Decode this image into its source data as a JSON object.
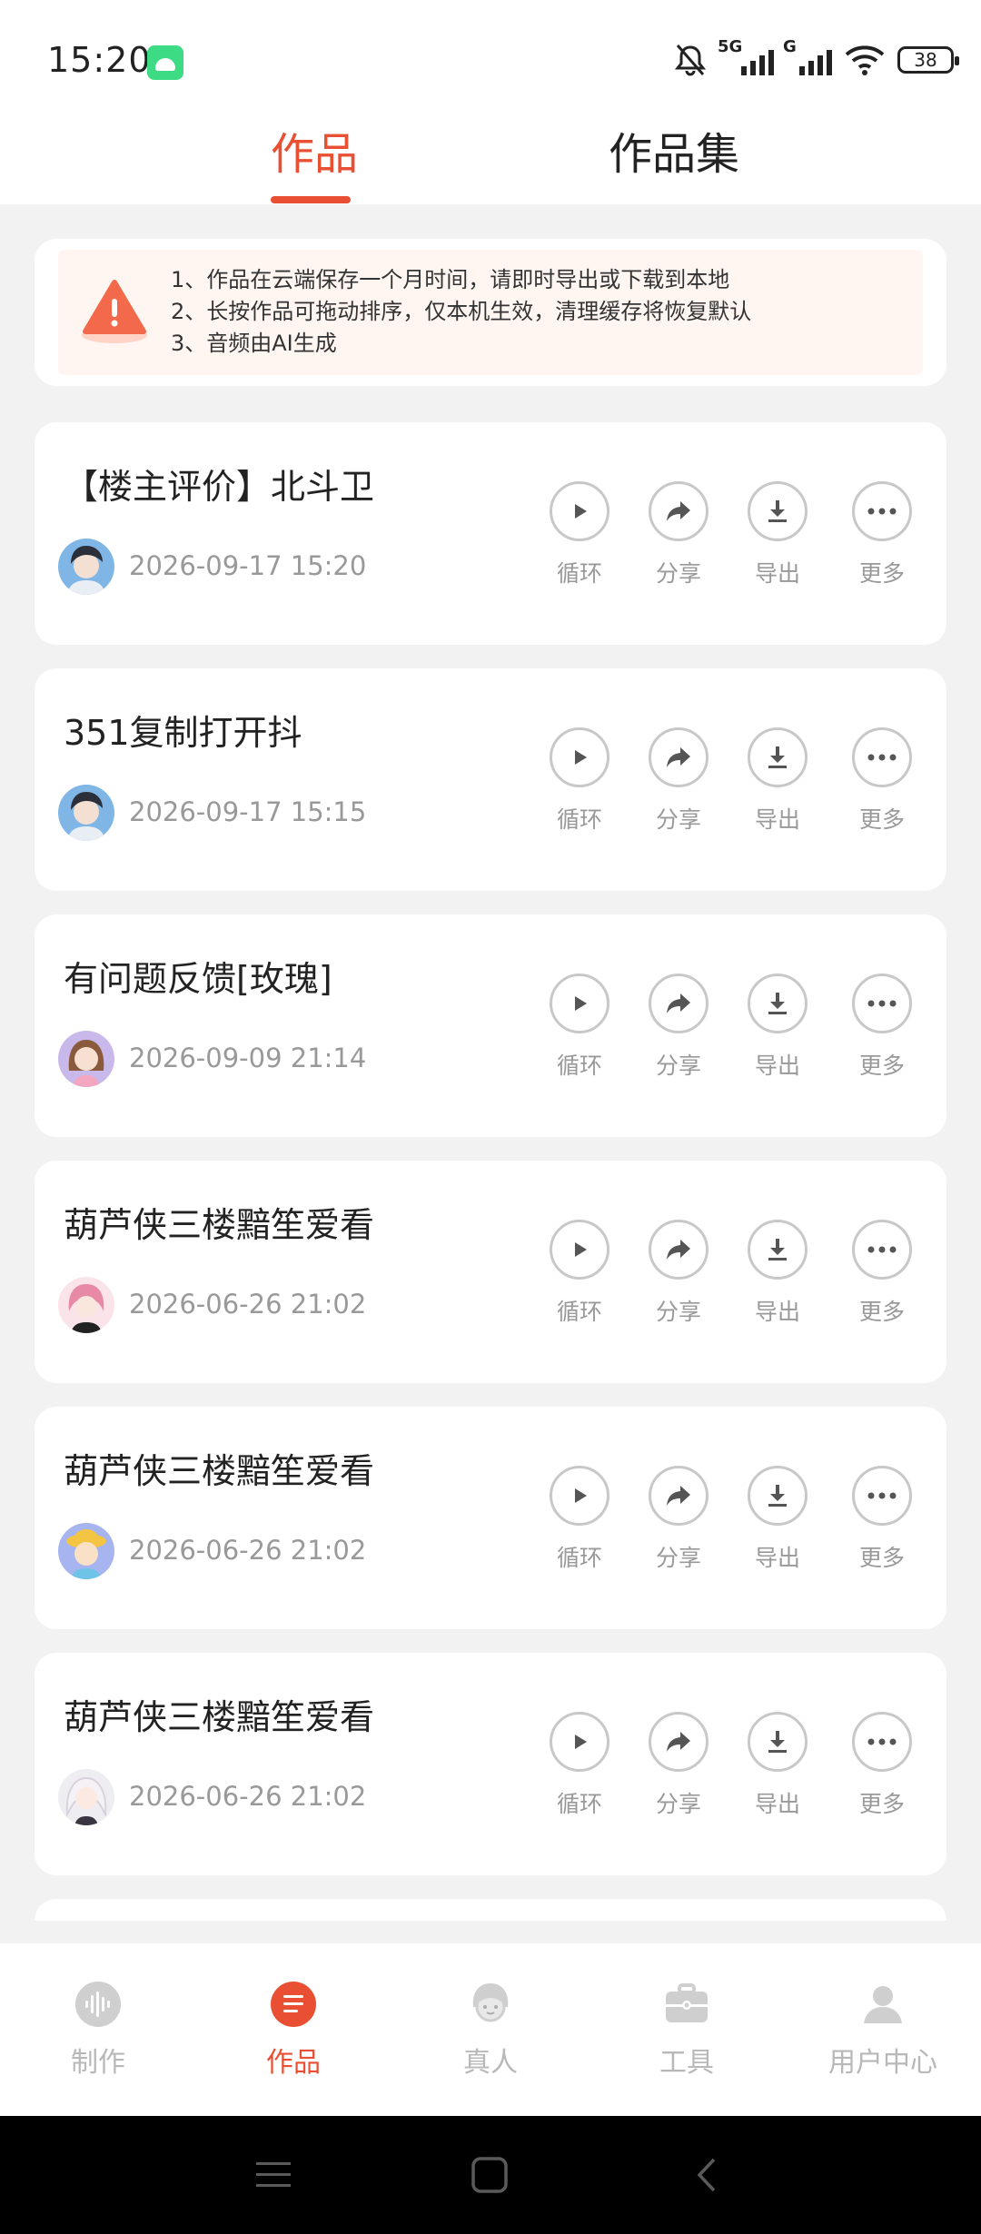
{
  "status_bar": {
    "time": "15:20",
    "network_tags": [
      "5G",
      "G"
    ],
    "battery": "38"
  },
  "tabs": [
    {
      "label": "作品",
      "active": true
    },
    {
      "label": "作品集",
      "active": false
    }
  ],
  "notice": {
    "lines": [
      "1、作品在云端保存一个月时间，请即时导出或下载到本地",
      "2、长按作品可拖动排序，仅本机生效，清理缓存将恢复默认",
      "3、音频由AI生成"
    ]
  },
  "actions": {
    "play": "循环",
    "share": "分享",
    "export": "导出",
    "more": "更多"
  },
  "works": [
    {
      "title": "【楼主评价】北斗卫",
      "date": "2026-09-17 15:20",
      "avatar": "boy-avatar"
    },
    {
      "title": "351复制打开抖",
      "date": "2026-09-17 15:15",
      "avatar": "boy-avatar"
    },
    {
      "title": "有问题反馈[玫瑰]",
      "date": "2026-09-09 21:14",
      "avatar": "girl-avatar"
    },
    {
      "title": "葫芦侠三楼黯笙爱看",
      "date": "2026-06-26 21:02",
      "avatar": "pink-hair-avatar"
    },
    {
      "title": "葫芦侠三楼黯笙爱看",
      "date": "2026-06-26 21:02",
      "avatar": "cartoon-kid-avatar"
    },
    {
      "title": "葫芦侠三楼黯笙爱看",
      "date": "2026-06-26 21:02",
      "avatar": "white-hair-avatar"
    }
  ],
  "bottom_nav": [
    {
      "label": "制作",
      "icon": "waveform-icon",
      "active": false
    },
    {
      "label": "作品",
      "icon": "list-icon",
      "active": true
    },
    {
      "label": "真人",
      "icon": "person-face-icon",
      "active": false
    },
    {
      "label": "工具",
      "icon": "toolbox-icon",
      "active": false
    },
    {
      "label": "用户中心",
      "icon": "user-icon",
      "active": false
    }
  ],
  "colors": {
    "accent": "#e94f33",
    "background": "#f2f2f2",
    "muted": "#999999"
  }
}
